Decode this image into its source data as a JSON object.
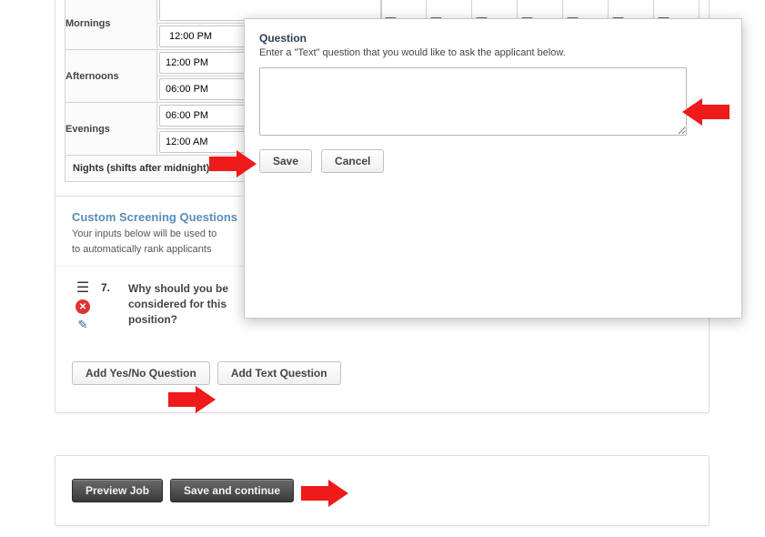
{
  "schedule": {
    "rows": [
      {
        "label": "Mornings",
        "times": [
          "",
          "12:00 PM"
        ],
        "select_second": true
      },
      {
        "label": "Afternoons",
        "times": [
          "12:00 PM",
          "06:00 PM"
        ]
      },
      {
        "label": "Evenings",
        "times": [
          "06:00 PM",
          "12:00 AM"
        ]
      }
    ],
    "nights_label": "Nights (shifts after midnight)",
    "day_checks": [
      true,
      true,
      true,
      true,
      true,
      true,
      true
    ]
  },
  "screening": {
    "heading": "Custom Screening Questions",
    "sub_line1": "Your inputs below will be used to",
    "sub_line2": "to automatically rank applicants",
    "q_number": "7.",
    "q_text": "Why should you be considered for this position?",
    "add_yesno_label": "Add Yes/No Question",
    "add_text_label": "Add Text Question"
  },
  "bottom": {
    "preview_label": "Preview Job",
    "save_continue_label": "Save and continue"
  },
  "popup": {
    "title": "Question",
    "sub": "Enter a \"Text\" question that you would like to ask the applicant below.",
    "value": "",
    "save_label": "Save",
    "cancel_label": "Cancel"
  }
}
